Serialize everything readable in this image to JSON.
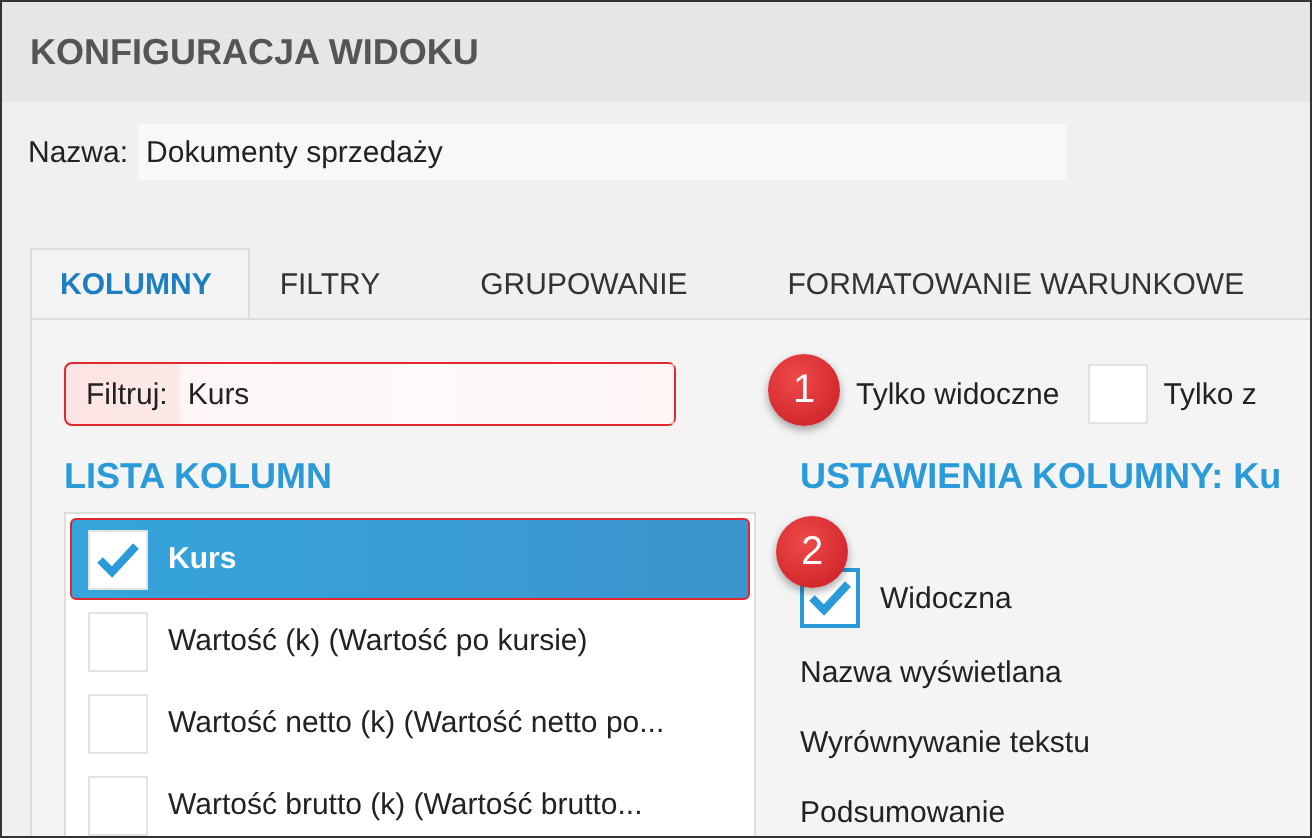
{
  "window": {
    "title": "KONFIGURACJA WIDOKU"
  },
  "name_field": {
    "label": "Nazwa:",
    "value": "Dokumenty sprzedaży"
  },
  "tabs": [
    {
      "label": "KOLUMNY",
      "selected": true
    },
    {
      "label": "FILTRY",
      "selected": false
    },
    {
      "label": "GRUPOWANIE",
      "selected": false
    },
    {
      "label": "FORMATOWANIE WARUNKOWE",
      "selected": false
    }
  ],
  "filter": {
    "label": "Filtruj:",
    "value": "Kurs",
    "options": [
      {
        "label": "Tylko widoczne"
      },
      {
        "label": "Tylko z",
        "checked": false
      }
    ]
  },
  "column_list": {
    "title": "LISTA KOLUMN",
    "items": [
      {
        "label": "Kurs",
        "checked": true,
        "selected": true
      },
      {
        "label": "Wartość (k) (Wartość po kursie)",
        "checked": false,
        "selected": false
      },
      {
        "label": "Wartość netto (k) (Wartość netto po...",
        "checked": false,
        "selected": false
      },
      {
        "label": "Wartość brutto (k) (Wartość brutto...",
        "checked": false,
        "selected": false
      }
    ]
  },
  "column_settings": {
    "title": "USTAWIENIA KOLUMNY: Ku",
    "visible": {
      "label": "Widoczna",
      "checked": true
    },
    "fields": [
      "Nazwa wyświetlana",
      "Wyrównywanie tekstu",
      "Podsumowanie"
    ]
  },
  "callouts": [
    "1",
    "2"
  ]
}
